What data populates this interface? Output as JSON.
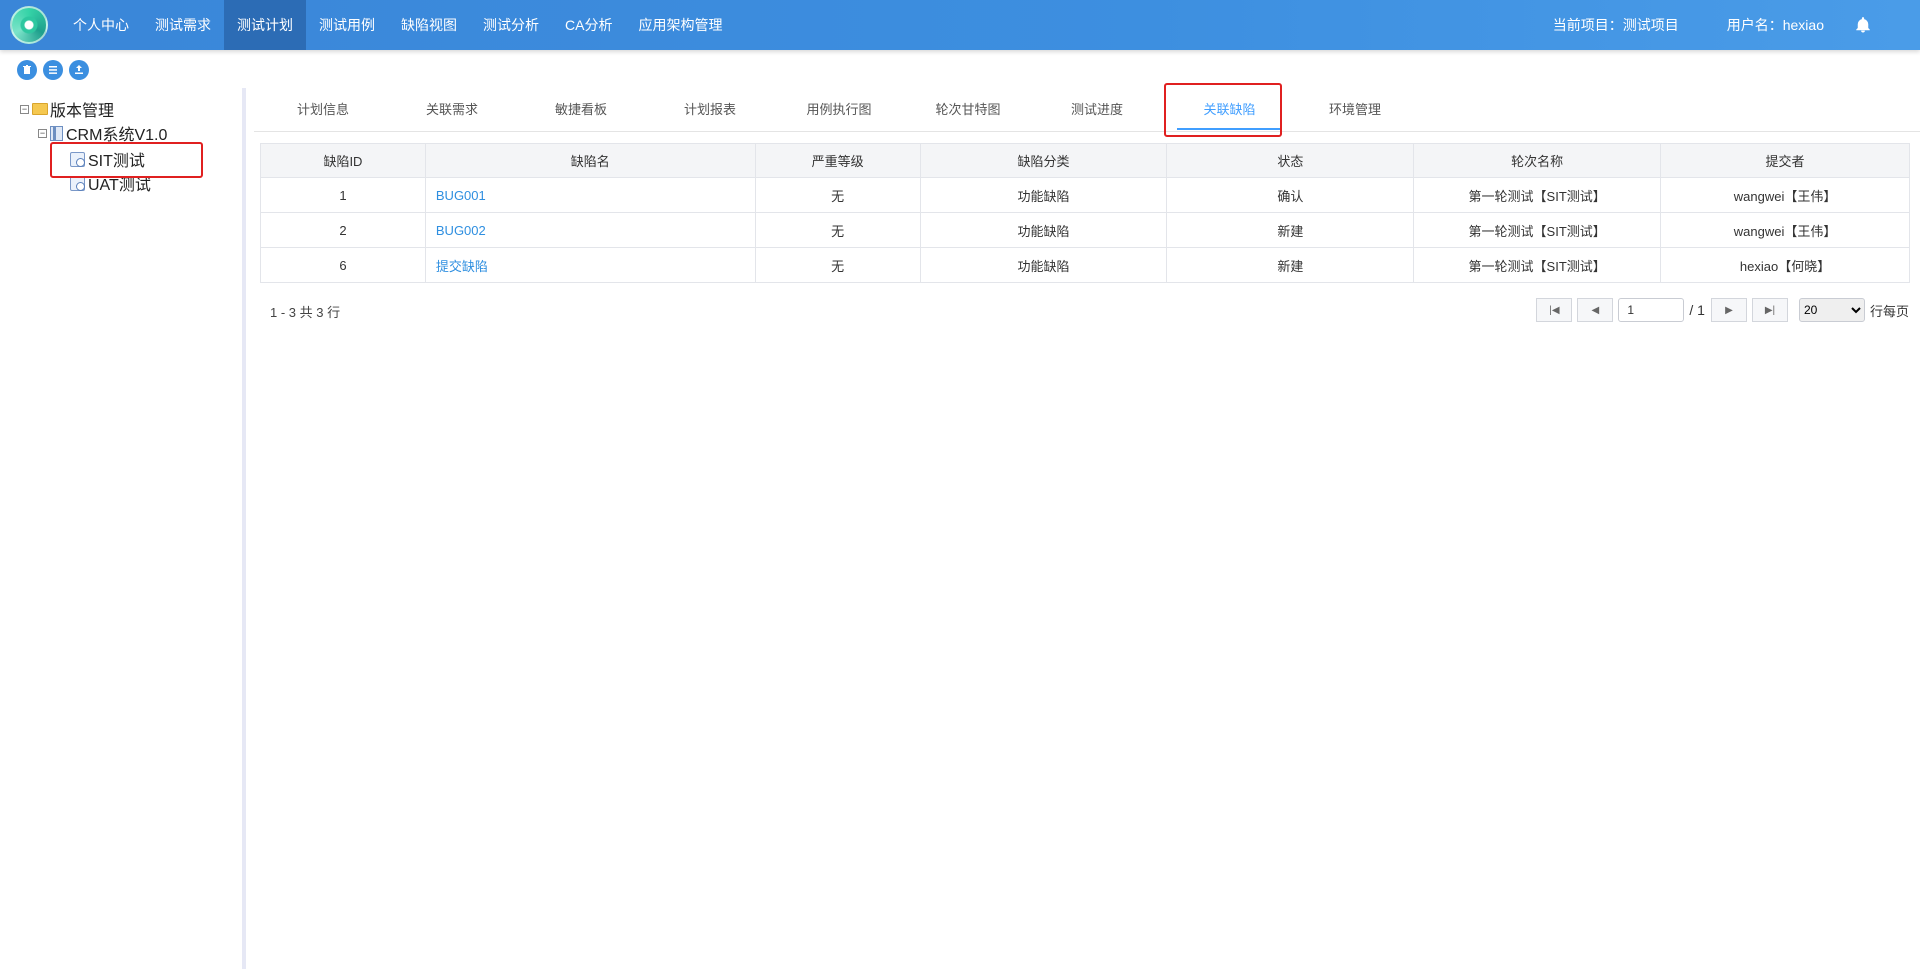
{
  "nav": {
    "items": [
      {
        "label": "个人中心"
      },
      {
        "label": "测试需求"
      },
      {
        "label": "测试计划"
      },
      {
        "label": "测试用例"
      },
      {
        "label": "缺陷视图"
      },
      {
        "label": "测试分析"
      },
      {
        "label": "CA分析"
      },
      {
        "label": "应用架构管理"
      }
    ],
    "active": "测试计划",
    "current_project": "当前项目：测试项目",
    "username": "用户名：hexiao"
  },
  "tree": {
    "root": "版本管理",
    "version": "CRM系统V1.0",
    "children": [
      "SIT测试",
      "UAT测试"
    ],
    "selected": "SIT测试"
  },
  "tabs": {
    "items": [
      {
        "label": "计划信息"
      },
      {
        "label": "关联需求"
      },
      {
        "label": "敏捷看板"
      },
      {
        "label": "计划报表"
      },
      {
        "label": "用例执行图"
      },
      {
        "label": "轮次甘特图"
      },
      {
        "label": "测试进度"
      },
      {
        "label": "关联缺陷"
      },
      {
        "label": "环境管理"
      }
    ],
    "active": "关联缺陷"
  },
  "table": {
    "headers": [
      "缺陷ID",
      "缺陷名",
      "严重等级",
      "缺陷分类",
      "状态",
      "轮次名称",
      "提交者"
    ],
    "rows": [
      [
        "1",
        "BUG001",
        "无",
        "功能缺陷",
        "确认",
        "第一轮测试【SIT测试】",
        "wangwei【王伟】"
      ],
      [
        "2",
        "BUG002",
        "无",
        "功能缺陷",
        "新建",
        "第一轮测试【SIT测试】",
        "wangwei【王伟】"
      ],
      [
        "6",
        "提交缺陷",
        "无",
        "功能缺陷",
        "新建",
        "第一轮测试【SIT测试】",
        "hexiao【何晓】"
      ]
    ]
  },
  "pager": {
    "summary": "1 - 3 共 3 行",
    "page": "1",
    "total_pages": "/ 1",
    "page_size": "20",
    "per_page_label": "行每页"
  },
  "colors": {
    "accent": "#409eff",
    "nav_bg": "#3d8fe0",
    "nav_active": "#2c6cb5",
    "highlight": "#e02020"
  }
}
